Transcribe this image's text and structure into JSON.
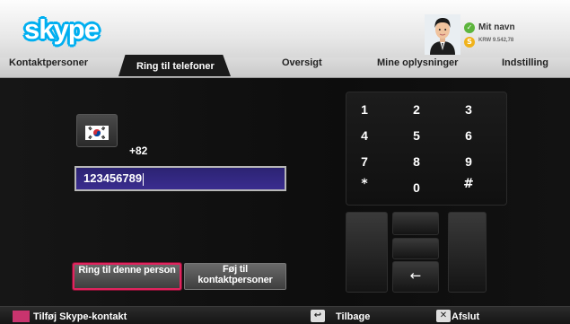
{
  "header": {
    "logo_text": "skype",
    "user_name": "Mit navn",
    "user_credit": "KRW 9.542,78"
  },
  "tabs": [
    {
      "label": "Kontaktpersoner",
      "active": false
    },
    {
      "label": "Ring til telefoner",
      "active": true
    },
    {
      "label": "Oversigt",
      "active": false
    },
    {
      "label": "Mine oplysninger",
      "active": false
    },
    {
      "label": "Indstilling",
      "active": false
    }
  ],
  "dialer": {
    "country_code": "+82",
    "country_flag": "south-korea-flag-icon",
    "phone_number": "123456789",
    "call_button": "Ring til denne person",
    "add_contact_button": "Føj til kontaktpersoner"
  },
  "keypad": {
    "keys": [
      "1",
      "2",
      "3",
      "4",
      "5",
      "6",
      "7",
      "8",
      "9",
      "*",
      "0",
      "#"
    ],
    "backspace_symbol": "←"
  },
  "bottombar": {
    "add_skype_contact": "Tilføj Skype-kontakt",
    "back": "Tilbage",
    "back_icon": "return-icon",
    "back_symbol": "↩",
    "exit": "Afslut",
    "exit_icon": "close-icon",
    "exit_symbol": "✕"
  },
  "colors": {
    "skype_blue": "#00aff0",
    "red_button": "#c8346e",
    "highlight_border": "#e0245e",
    "input_background": "#2c2373"
  }
}
